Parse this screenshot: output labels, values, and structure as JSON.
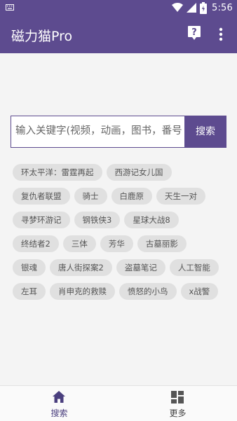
{
  "status": {
    "time": "5:56"
  },
  "appbar": {
    "title": "磁力猫Pro"
  },
  "search": {
    "placeholder": "输入关键字(视频，动画，图书，番号",
    "button_label": "搜索"
  },
  "tags": [
    [
      "环太平洋：雷霆再起",
      "西游记女儿国"
    ],
    [
      "复仇者联盟",
      "骑士",
      "白鹿原",
      "天生一对"
    ],
    [
      "寻梦环游记",
      "钢铁侠3",
      "星球大战8"
    ],
    [
      "终结者2",
      "三体",
      "芳华",
      "古墓丽影"
    ],
    [
      "银魂",
      "唐人街探案2",
      "盗墓笔记",
      "人工智能"
    ],
    [
      "左耳",
      "肖申克的救赎",
      "愤怒的小鸟",
      "x战警"
    ]
  ],
  "nav": {
    "search_label": "搜索",
    "more_label": "更多"
  },
  "colors": {
    "primary": "#5d4b8f",
    "tag_bg": "#e0e0e0",
    "nav_active": "#4a3f7e"
  },
  "icons": [
    "keyboard-icon",
    "wifi-icon",
    "signal-icon",
    "battery-icon",
    "help-icon",
    "more-vert-icon",
    "home-icon",
    "dashboard-icon"
  ]
}
